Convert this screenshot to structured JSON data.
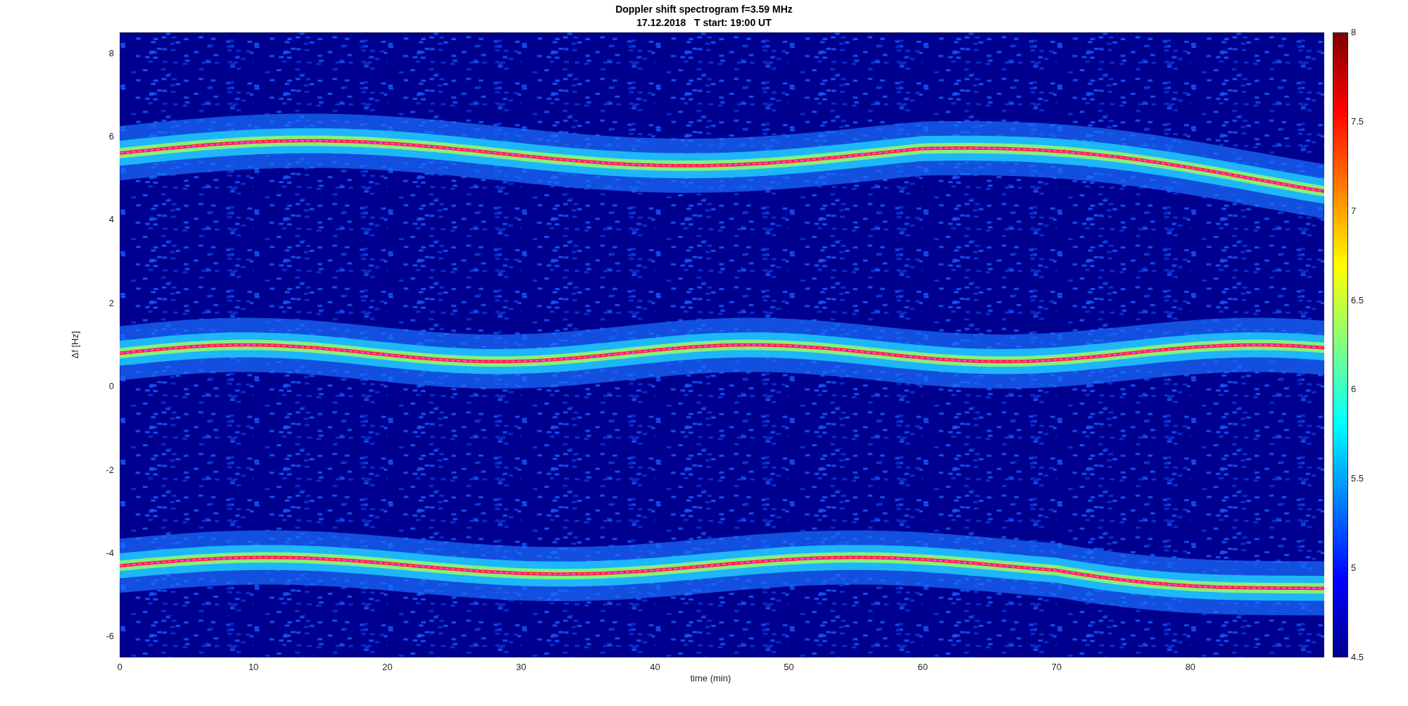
{
  "figure": {
    "title": [
      "Doppler shift spectrogram f=3.59 MHz",
      "17.12.2018   T start: 19:00 UT"
    ],
    "xlabel": "time (min)",
    "ylabel": "Δf [Hz]",
    "xticks": [
      "0",
      "10",
      "20",
      "30",
      "40",
      "50",
      "60",
      "70",
      "80"
    ],
    "yticks": [
      "8",
      "6",
      "4",
      "2",
      "0",
      "-2",
      "-4",
      "-6"
    ],
    "colorbar": {
      "ticks": [
        "8",
        "7.5",
        "7",
        "6.5",
        "6",
        "5.5",
        "5",
        "4.5"
      ]
    }
  }
}
